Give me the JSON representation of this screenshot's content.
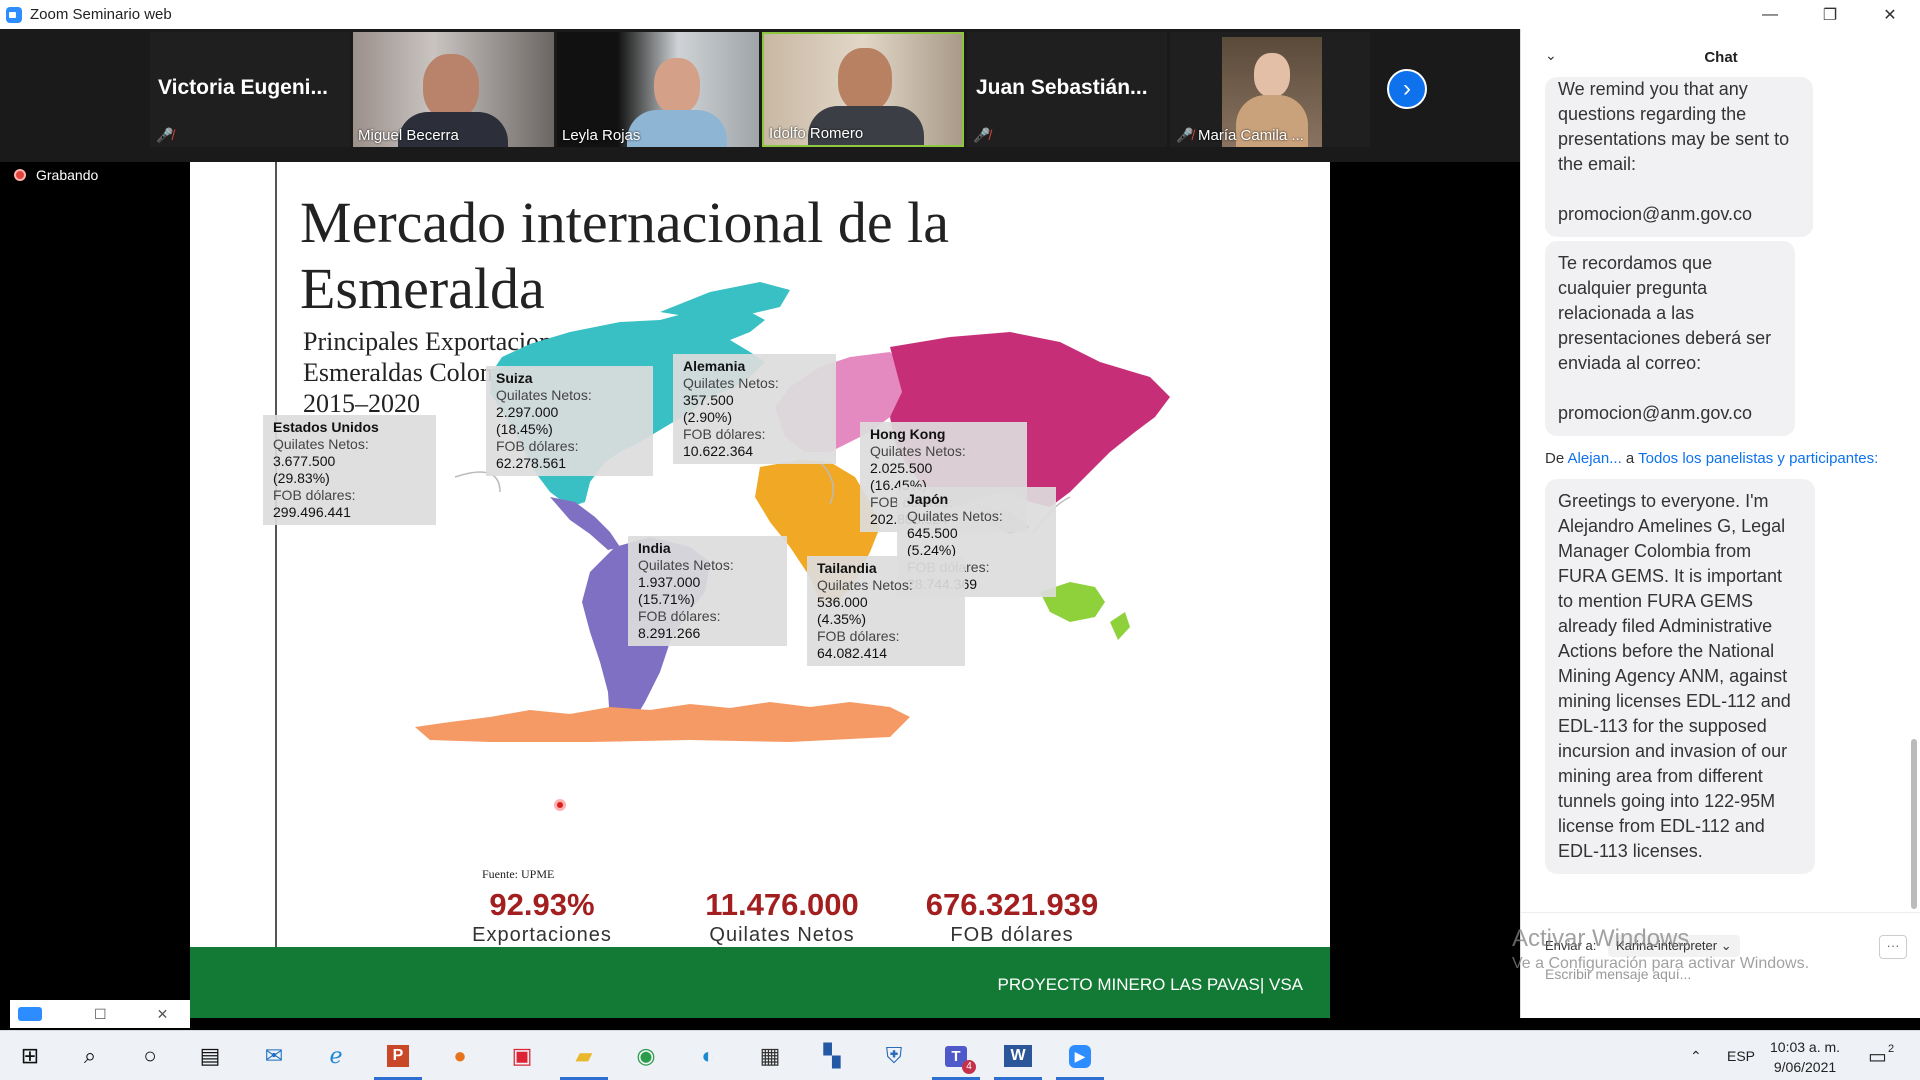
{
  "window": {
    "title": "Zoom Seminario web",
    "min": "—",
    "max": "❐",
    "close": "✕"
  },
  "participants": [
    {
      "name": "Victoria  Eugeni...",
      "video": false,
      "muted": true
    },
    {
      "name": "Miguel Becerra",
      "video": true,
      "muted": false
    },
    {
      "name": "Leyla Rojas",
      "video": true,
      "muted": false
    },
    {
      "name": "Idolfo Romero",
      "video": true,
      "muted": false,
      "speaking": true
    },
    {
      "name": "Juan  Sebastián...",
      "video": false,
      "muted": true
    },
    {
      "name": "María Camila ...",
      "video": true,
      "muted": true
    }
  ],
  "recording_label": "Grabando",
  "slide": {
    "title": "Mercado internacional de la Esmeralda",
    "subtitle_lines": [
      "Principales Exportaciones",
      "Esmeraldas Colombianas",
      "2015–2020"
    ],
    "callouts": [
      {
        "country": "Estados Unidos",
        "quilates_label": "Quilates Netos:",
        "quilates": "3.677.500",
        "pct": "(29.83%)",
        "fob_label": "FOB dólares:",
        "fob": "299.496.441"
      },
      {
        "country": "Suiza",
        "quilates_label": "Quilates Netos:",
        "quilates": "2.297.000",
        "pct": "(18.45%)",
        "fob_label": "FOB dólares:",
        "fob": "62.278.561"
      },
      {
        "country": "Alemania",
        "quilates_label": "Quilates Netos:",
        "quilates": "357.500",
        "pct": "(2.90%)",
        "fob_label": "FOB dólares:",
        "fob": "10.622.364"
      },
      {
        "country": "Hong Kong",
        "quilates_label": "Quilates Netos:",
        "quilates": "2.025.500",
        "pct": "(16.45%)",
        "fob_label": "FOB dólares:",
        "fob": "202.806.524"
      },
      {
        "country": "Japón",
        "quilates_label": "Quilates Netos:",
        "quilates": "645.500",
        "pct": "(5.24%)",
        "fob_label": "FOB dólares:",
        "fob": "28.744.369"
      },
      {
        "country": "India",
        "quilates_label": "Quilates Netos:",
        "quilates": "1.937.000",
        "pct": "(15.71%)",
        "fob_label": "FOB dólares:",
        "fob": "8.291.266"
      },
      {
        "country": "Tailandia",
        "quilates_label": "Quilates Netos:",
        "quilates": "536.000",
        "pct": "(4.35%)",
        "fob_label": "FOB dólares:",
        "fob": "64.082.414"
      }
    ],
    "source": "Fuente: UPME",
    "stats": [
      {
        "value": "92.93%",
        "label": "Exportaciones"
      },
      {
        "value": "11.476.000",
        "label": "Quilates Netos"
      },
      {
        "value": "676.321.939",
        "label": "FOB dólares"
      }
    ],
    "footer": "PROYECTO MINERO LAS PAVAS| VSA",
    "colors": {
      "americas_north": "#38c0c4",
      "americas_south": "#7f70c4",
      "europe": "#e58ac0",
      "asia": "#c62f78",
      "africa": "#f0a825",
      "oceania": "#8fd13a",
      "antarctica": "#f59a64",
      "footer": "#137a35",
      "stat": "#a31f1f"
    }
  },
  "chat": {
    "title": "Chat",
    "messages": [
      {
        "lines": [
          "We remind you that any",
          "questions regarding the",
          "presentations may be sent to",
          "the email:",
          "",
          "promocion@anm.gov.co"
        ]
      },
      {
        "lines": [
          "Te recordamos que",
          "cualquier pregunta",
          "relacionada a las",
          "presentaciones deberá ser",
          "enviada al correo:",
          "",
          "promocion@anm.gov.co"
        ]
      },
      {
        "lines": [
          "Greetings to everyone. I'm",
          "Alejandro Amelines G, Legal",
          "Manager Colombia from",
          "FURA GEMS. It is important",
          "to mention FURA GEMS",
          "already filed Administrative",
          "Actions before the National",
          "Mining Agency ANM, against",
          "mining licenses EDL-112 and",
          "EDL-113 for the supposed",
          "incursion and invasion of our",
          "mining area from different",
          "tunnels going into 122-95M",
          "license from EDL-112 and",
          "EDL-113 licenses."
        ]
      }
    ],
    "from_prefix": "De",
    "from_name": "Alejan...",
    "to_prefix": "a",
    "to_name": "Todos los panelistas y participantes:",
    "send_to_label": "Enviar a:",
    "send_to_value": "Karina-interpreter ⌄",
    "more": "···",
    "placeholder": "Escribir mensaje aquí..."
  },
  "watermark": {
    "line1": "Activar Windows",
    "line2": "Ve a Configuración para activar Windows."
  },
  "taskbar": {
    "lang": "ESP",
    "time": "10:03 a. m.",
    "date": "9/06/2021",
    "notif_count": "2",
    "teams_badge": "4"
  }
}
